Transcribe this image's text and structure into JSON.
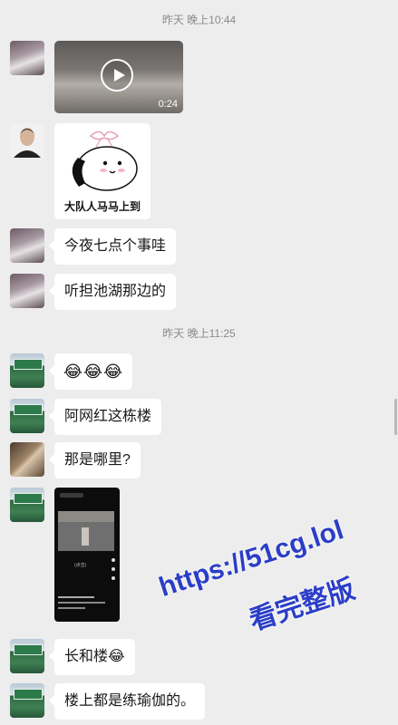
{
  "timestamps": [
    "昨天 晚上10:44",
    "昨天 晚上11:25"
  ],
  "messages": {
    "video_duration": "0:24",
    "sticker_caption": "大队人马马上到",
    "m1": "今夜七点个事哇",
    "m2": "听担池湖那边的",
    "m4": "阿网红这栋楼",
    "m5": "那是哪里?",
    "m6": "长和楼",
    "m7": "楼上都是练瑜伽的。"
  },
  "emoji": {
    "laughing_tears": "😂"
  },
  "phone_screenshot": {
    "caption": "(点击)"
  },
  "watermark": {
    "line1": "https://51cg.lol",
    "line2": "看完整版"
  }
}
